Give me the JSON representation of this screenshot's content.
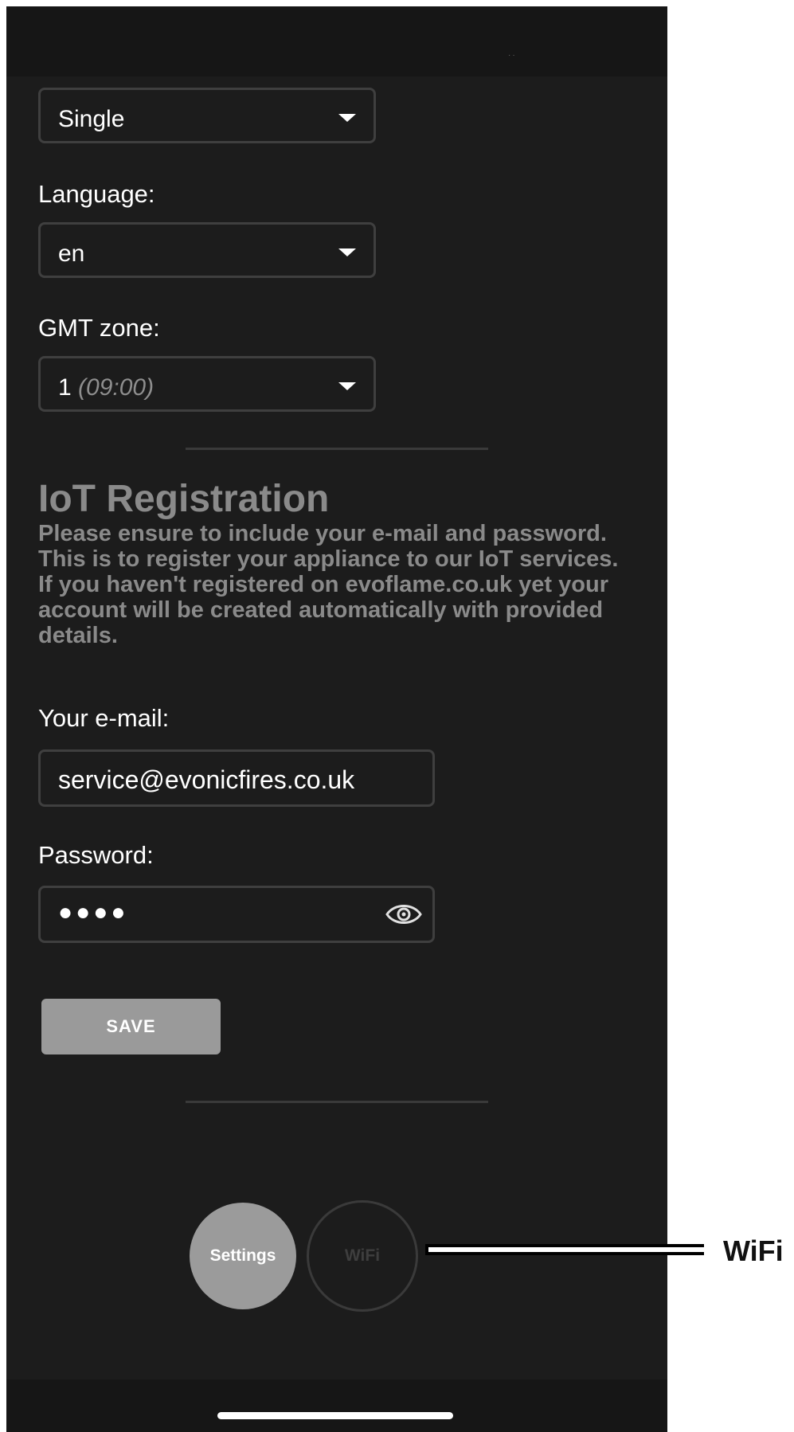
{
  "mode_select": {
    "value": "Single"
  },
  "language": {
    "label": "Language:",
    "value": "en"
  },
  "gmt": {
    "label": "GMT zone:",
    "value": "1",
    "hint": "(09:00)"
  },
  "iot": {
    "title": "IoT Registration",
    "paragraph1": "Please ensure to include your e-mail and password. This is to register your appliance to our IoT services.",
    "paragraph2": "If you haven't registered on evoflame.co.uk yet your account will be created automatically with provided details."
  },
  "email": {
    "label": "Your e-mail:",
    "value": "service@evonicfires.co.uk"
  },
  "password": {
    "label": "Password:",
    "masked_value": "●●●●",
    "toggle_icon": "eye-icon"
  },
  "save_button": {
    "label": "SAVE"
  },
  "nav": {
    "settings_label": "Settings",
    "wifi_label": "WiFi"
  },
  "callout": {
    "label": "WiFi"
  },
  "colors": {
    "background": "#1c1c1c",
    "muted_text": "#8a8a8a",
    "button": "#9a9a9a",
    "border": "#3f3f3f"
  }
}
